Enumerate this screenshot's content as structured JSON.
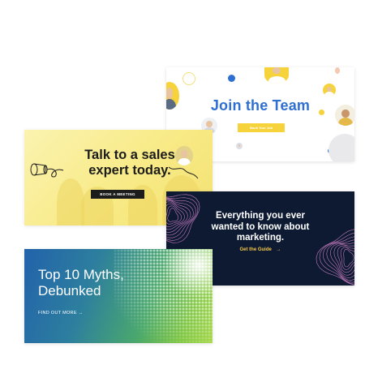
{
  "cards": {
    "team": {
      "title": "Join the Team",
      "button_label": "Book Your Job"
    },
    "sales": {
      "headline": "Talk to a sales expert today.",
      "button_label": "BOOK A MEETING"
    },
    "marketing": {
      "headline": "Everything you ever wanted to know about marketing.",
      "link_label": "Get the Guide",
      "link_arrow": "→"
    },
    "myths": {
      "headline": "Top 10 Myths, Debunked",
      "link_label": "FIND OUT MORE →"
    }
  },
  "colors": {
    "team_title": "#2e6fd1",
    "team_button": "#f6d23b",
    "sales_bg": "#f8ea86",
    "marketing_bg": "#0d1a32",
    "marketing_link": "#f7c948",
    "wave_pink": "#e58bd6",
    "myths_blue": "#2262ab",
    "myths_green": "#7fc642"
  }
}
